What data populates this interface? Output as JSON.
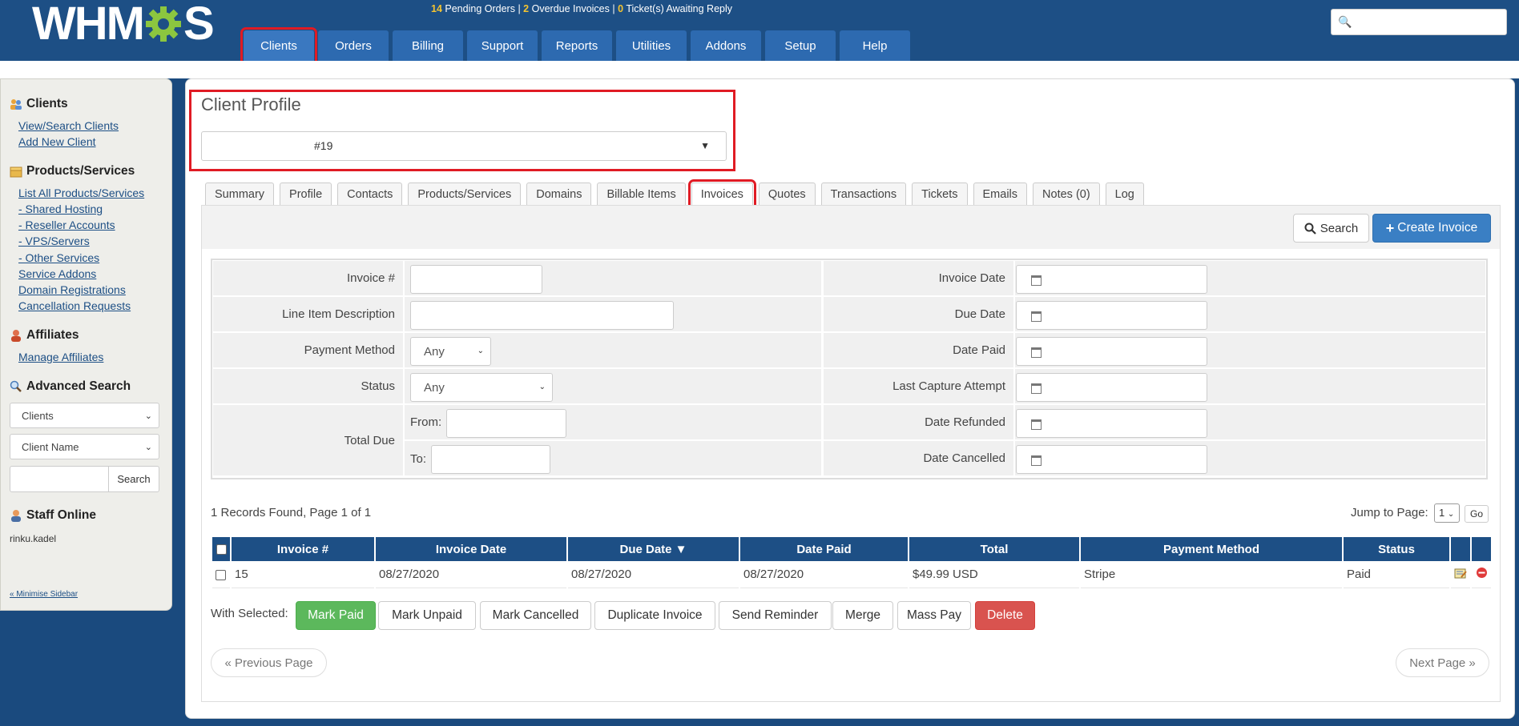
{
  "header": {
    "logo_text": "WHM",
    "logo_text_end": "S",
    "status": {
      "pending_orders_count": "14",
      "pending_orders_label": "Pending Orders",
      "overdue_invoices_count": "2",
      "overdue_invoices_label": "Overdue Invoices",
      "tickets_count": "0",
      "tickets_label": "Ticket(s) Awaiting Reply",
      "separator": "|"
    },
    "nav": [
      "Clients",
      "Orders",
      "Billing",
      "Support",
      "Reports",
      "Utilities",
      "Addons",
      "Setup",
      "Help"
    ],
    "active_nav": "Clients",
    "search_placeholder": ""
  },
  "sidebar": {
    "clients_heading": "Clients",
    "clients_links": [
      "View/Search Clients",
      "Add New Client"
    ],
    "products_heading": "Products/Services",
    "products_links": [
      "List All Products/Services",
      "- Shared Hosting",
      "- Reseller Accounts",
      "- VPS/Servers",
      "- Other Services",
      "Service Addons",
      "Domain Registrations",
      "Cancellation Requests"
    ],
    "affiliates_heading": "Affiliates",
    "affiliates_links": [
      "Manage Affiliates"
    ],
    "advanced_search_heading": "Advanced Search",
    "adv_select_1": "Clients",
    "adv_select_2": "Client Name",
    "adv_search_button": "Search",
    "staff_heading": "Staff Online",
    "staff_name": "rinku.kadel",
    "minimise_link": "« Minimise Sidebar"
  },
  "profile": {
    "title": "Client Profile",
    "selected_client": "#19"
  },
  "tabs": [
    "Summary",
    "Profile",
    "Contacts",
    "Products/Services",
    "Domains",
    "Billable Items",
    "Invoices",
    "Quotes",
    "Transactions",
    "Tickets",
    "Emails",
    "Notes (0)",
    "Log"
  ],
  "active_tab": "Invoices",
  "toolbar": {
    "search_label": "Search",
    "create_label": "Create Invoice"
  },
  "search_form": {
    "invoice_num_label": "Invoice #",
    "line_item_label": "Line Item Description",
    "payment_method_label": "Payment Method",
    "payment_method_value": "Any",
    "status_label": "Status",
    "status_value": "Any",
    "total_due_label": "Total Due",
    "from_label": "From:",
    "to_label": "To:",
    "invoice_date_label": "Invoice Date",
    "due_date_label": "Due Date",
    "date_paid_label": "Date Paid",
    "last_capture_label": "Last Capture Attempt",
    "date_refunded_label": "Date Refunded",
    "date_cancelled_label": "Date Cancelled"
  },
  "results": {
    "records_text": "1 Records Found, Page 1 of 1",
    "jump_label": "Jump to Page:",
    "jump_value": "1",
    "go_label": "Go"
  },
  "table": {
    "headers": [
      "Invoice #",
      "Invoice Date",
      "Due Date ▼",
      "Date Paid",
      "Total",
      "Payment Method",
      "Status"
    ],
    "rows": [
      {
        "invoice": "15",
        "invoice_date": "08/27/2020",
        "due_date": "08/27/2020",
        "date_paid": "08/27/2020",
        "total": "$49.99 USD",
        "payment_method": "Stripe",
        "status": "Paid"
      }
    ]
  },
  "bulk_actions": {
    "with_selected": "With Selected:",
    "buttons": [
      "Mark Paid",
      "Mark Unpaid",
      "Mark Cancelled",
      "Duplicate Invoice",
      "Send Reminder",
      "Merge",
      "Mass Pay",
      "Delete"
    ]
  },
  "pagination": {
    "prev": "« Previous Page",
    "next": "Next Page »"
  },
  "colors": {
    "header_blue": "#1d4f85",
    "highlight_red": "#e01b24",
    "green": "#5cb85c",
    "red": "#d9534f",
    "primary": "#3a7fc4"
  }
}
